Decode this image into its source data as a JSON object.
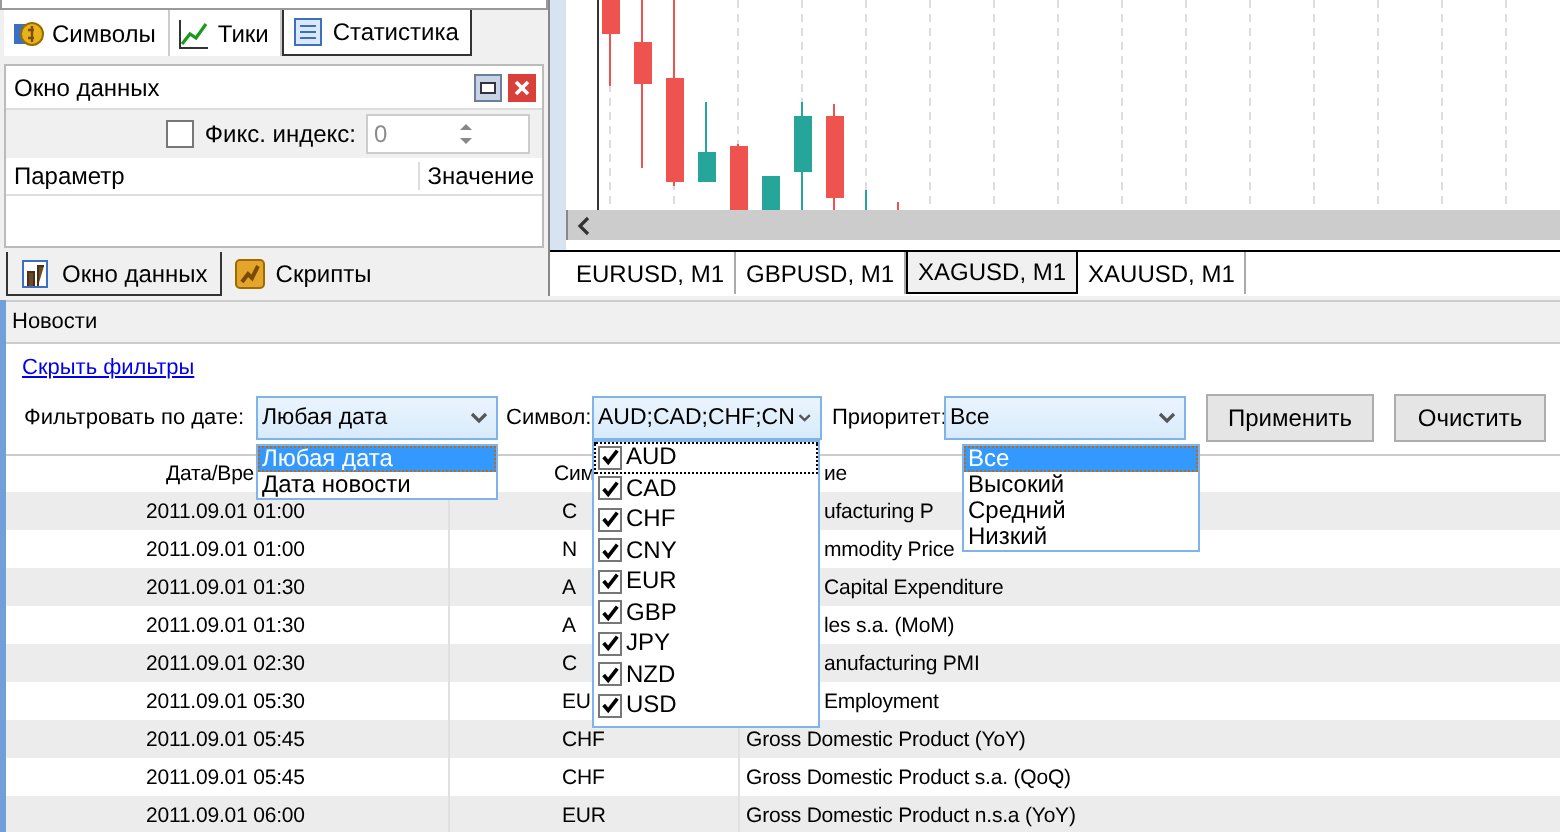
{
  "left_tabs": [
    {
      "label": "Символы",
      "selected": false
    },
    {
      "label": "Тики",
      "selected": false
    },
    {
      "label": "Статистика",
      "selected": true
    }
  ],
  "data_window": {
    "title": "Окно данных",
    "fix_index": {
      "label": "Фикс. индекс:",
      "checked": false
    },
    "index_field": {
      "value": "0",
      "disabled": true
    },
    "columns": [
      "Параметр",
      "Значение"
    ]
  },
  "bottom_tabs": [
    {
      "label": "Окно данных",
      "selected": true
    },
    {
      "label": "Скрипты",
      "selected": false
    }
  ],
  "chart_tabs": [
    {
      "label": "EURUSD, M1",
      "selected": false
    },
    {
      "label": "GBPUSD, M1",
      "selected": false
    },
    {
      "label": "XAGUSD, M1",
      "selected": true
    },
    {
      "label": "XAUUSD, M1",
      "selected": false
    }
  ],
  "news": {
    "title": "Новости",
    "hide_filters_link": "Скрыть фильтры",
    "date_filter": {
      "label": "Фильтровать по дате:",
      "value": "Любая дата",
      "options": [
        {
          "label": "Любая дата",
          "selected": true
        },
        {
          "label": "Дата новости",
          "selected": false
        }
      ]
    },
    "symbol_filter": {
      "label": "Символ:",
      "value": "AUD;CAD;CHF;CN",
      "options": [
        {
          "label": "AUD",
          "checked": true,
          "selected": true
        },
        {
          "label": "CAD",
          "checked": true,
          "selected": false
        },
        {
          "label": "CHF",
          "checked": true,
          "selected": false
        },
        {
          "label": "CNY",
          "checked": true,
          "selected": false
        },
        {
          "label": "EUR",
          "checked": true,
          "selected": false
        },
        {
          "label": "GBP",
          "checked": true,
          "selected": false
        },
        {
          "label": "JPY",
          "checked": true,
          "selected": false
        },
        {
          "label": "NZD",
          "checked": true,
          "selected": false
        },
        {
          "label": "USD",
          "checked": true,
          "selected": false
        }
      ]
    },
    "priority_filter": {
      "label": "Приоритет:",
      "value": "Все",
      "options": [
        {
          "label": "Все",
          "selected": true
        },
        {
          "label": "Высокий",
          "selected": false
        },
        {
          "label": "Средний",
          "selected": false
        },
        {
          "label": "Низкий",
          "selected": false
        }
      ]
    },
    "buttons": [
      "Применить",
      "Очистить"
    ],
    "columns": [
      "Дата/Вре",
      "Сим",
      "ие"
    ],
    "rows": [
      {
        "date": "2011.09.01 01:00",
        "symbol": "C",
        "name": "ufacturing P"
      },
      {
        "date": "2011.09.01 01:00",
        "symbol": "N",
        "name": "mmodity Price"
      },
      {
        "date": "2011.09.01 01:30",
        "symbol": "A",
        "name": "Capital Expenditure"
      },
      {
        "date": "2011.09.01 01:30",
        "symbol": "A",
        "name": "les s.a. (MoM)"
      },
      {
        "date": "2011.09.01 02:30",
        "symbol": "C",
        "name": "anufacturing PMI"
      },
      {
        "date": "2011.09.01 05:30",
        "symbol": "EU",
        "name": "Employment"
      },
      {
        "date": "2011.09.01 05:45",
        "symbol": "CHF",
        "name": "Gross Domestic Product (YoY)"
      },
      {
        "date": "2011.09.01 05:45",
        "symbol": "CHF",
        "name": "Gross Domestic Product s.a. (QoQ)"
      },
      {
        "date": "2011.09.01 06:00",
        "symbol": "EUR",
        "name": "Gross Domestic Product n.s.a (YoY)"
      }
    ]
  }
}
